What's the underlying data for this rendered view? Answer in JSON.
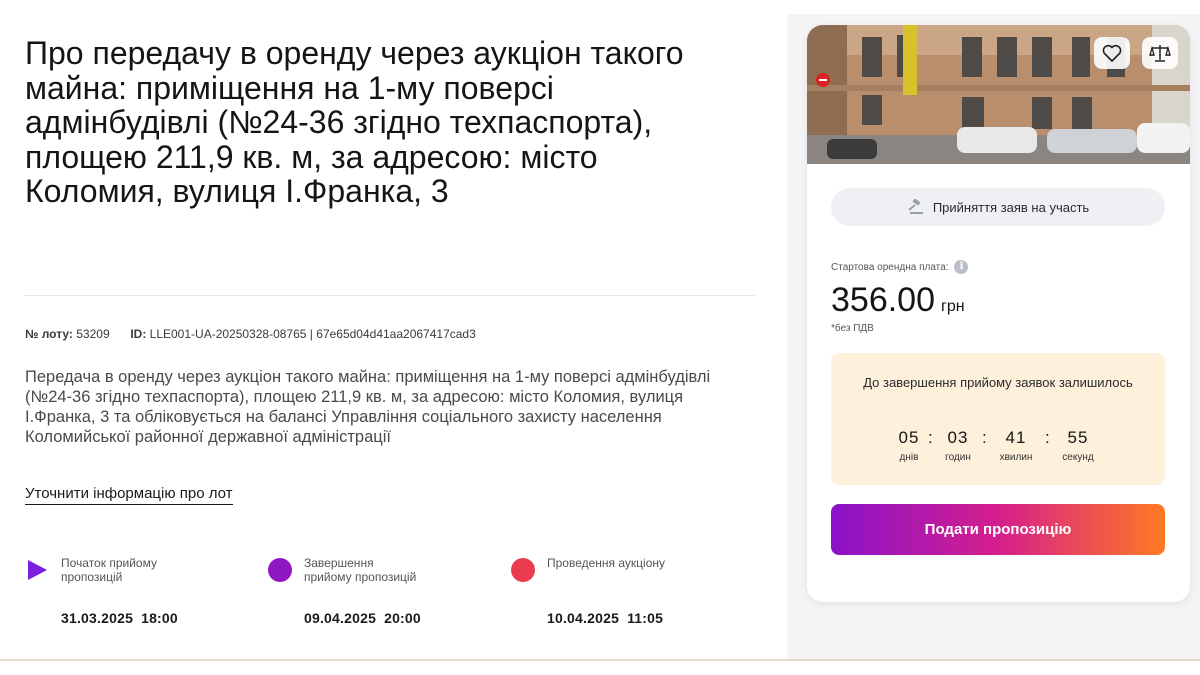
{
  "lot": {
    "title": "Про передачу в оренду через аукціон такого майна: приміщення на 1-му поверсі адмінбудівлі (№24-36 згідно техпаспорта), площею 211,9 кв. м, за адресою: місто Коломия, вулиця І.Франка, 3",
    "lot_number_label": "№ лоту:",
    "lot_number": "53209",
    "id_label": "ID:",
    "id_value": "LLE001-UA-20250328-08765",
    "separator": "|",
    "hash": "67e65d04d41aa2067417cad3",
    "description": "Передача в оренду через аукціон такого майна: приміщення на 1-му поверсі адмінбудівлі (№24-36 згідно техпаспорта), площею 211,9 кв. м, за адресою: місто Коломия, вулиця І.Франка, 3 та обліковується на балансі Управління соціального захисту населення Коломийської районної державної адміністрації",
    "more_link": "Уточнити інформацію про лот"
  },
  "timeline": [
    {
      "label": "Початок прийому пропозицій",
      "date": "31.03.2025",
      "time": "18:00",
      "icon": "play-icon",
      "color": "#7b1ee0"
    },
    {
      "label": "Завершення прийому пропозицій",
      "date": "09.04.2025",
      "time": "20:00",
      "icon": "circle-icon",
      "color": "#8f17c2"
    },
    {
      "label": "Проведення аукціону",
      "date": "10.04.2025",
      "time": "11:05",
      "icon": "circle-icon",
      "color": "#ea3b4f"
    }
  ],
  "card": {
    "favorite_icon": "heart-icon",
    "compare_icon": "scales-icon",
    "status": "Прийняття заяв на участь",
    "status_icon": "gavel-icon",
    "price_label": "Стартова орендна плата:",
    "price": "356.00",
    "currency": "грн",
    "vat_note": "*без ПДВ",
    "countdown": {
      "title": "До завершення прийому заявок залишилось",
      "days": "05",
      "days_label": "днів",
      "hours": "03",
      "hours_label": "годин",
      "minutes": "41",
      "minutes_label": "хвилин",
      "seconds": "55",
      "seconds_label": "секунд",
      "separator": ":"
    },
    "submit_button": "Подати пропозицію"
  },
  "colors": {
    "accent_purple": "#8a12c9",
    "accent_orange": "#ff7a22",
    "countdown_bg": "#fdf1dc",
    "pill_bg": "#eef0f3"
  }
}
